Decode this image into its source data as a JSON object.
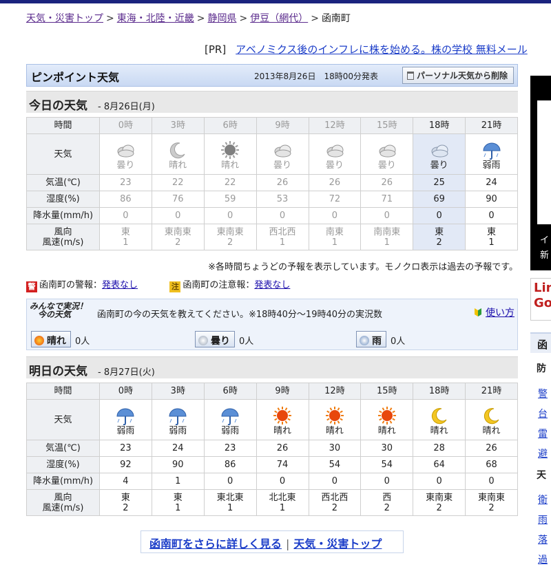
{
  "breadcrumb": {
    "items": [
      "天気・災害トップ",
      "東海・北陸・近畿",
      "静岡県",
      "伊豆（網代）"
    ],
    "current": "函南町",
    "separator": ">"
  },
  "ad": {
    "tag": "[PR]",
    "text": "アベノミクス後のインフレに株を始める。株の学校 無料メール"
  },
  "pinpoint": {
    "title": "ピンポイント天気",
    "published": "2013年8月26日　18時00分発表",
    "remove_button": "パーソナル天気から削除"
  },
  "row_labels": {
    "time": "時間",
    "weather": "天気",
    "temp": "気温(℃)",
    "humidity": "湿度(%)",
    "precip": "降水量(mm/h)",
    "wind_dir": "風向",
    "wind_speed": "風速(m/s)"
  },
  "today": {
    "title": "今日の天気",
    "date": "- 8月26日(月)",
    "columns": [
      {
        "time": "0時",
        "icon": "cloudy-icon",
        "weather": "曇り",
        "temp": "23",
        "humidity": "86",
        "precip": "0",
        "wind_dir": "東",
        "wind_speed": "1",
        "past": true
      },
      {
        "time": "3時",
        "icon": "moon-icon",
        "weather": "晴れ",
        "temp": "22",
        "humidity": "76",
        "precip": "0",
        "wind_dir": "東南東",
        "wind_speed": "2",
        "past": true
      },
      {
        "time": "6時",
        "icon": "sun-icon",
        "weather": "晴れ",
        "temp": "22",
        "humidity": "59",
        "precip": "0",
        "wind_dir": "東南東",
        "wind_speed": "2",
        "past": true
      },
      {
        "time": "9時",
        "icon": "cloudy-icon",
        "weather": "曇り",
        "temp": "26",
        "humidity": "53",
        "precip": "0",
        "wind_dir": "西北西",
        "wind_speed": "1",
        "past": true
      },
      {
        "time": "12時",
        "icon": "cloudy-icon",
        "weather": "曇り",
        "temp": "26",
        "humidity": "72",
        "precip": "0",
        "wind_dir": "南東",
        "wind_speed": "1",
        "past": true
      },
      {
        "time": "15時",
        "icon": "cloudy-icon",
        "weather": "曇り",
        "temp": "26",
        "humidity": "71",
        "precip": "0",
        "wind_dir": "南南東",
        "wind_speed": "1",
        "past": true
      },
      {
        "time": "18時",
        "icon": "cloudy-icon",
        "weather": "曇り",
        "temp": "25",
        "humidity": "69",
        "precip": "0",
        "wind_dir": "東",
        "wind_speed": "2",
        "past": false
      },
      {
        "time": "21時",
        "icon": "rain-icon",
        "weather": "弱雨",
        "temp": "24",
        "humidity": "90",
        "precip": "0",
        "wind_dir": "東",
        "wind_speed": "1",
        "past": false
      }
    ]
  },
  "note": "※各時間ちょうどの予報を表示しています。モノクロ表示は過去の予報です。",
  "alerts": {
    "warning_badge": "警",
    "warning_label": "函南町の警報：",
    "warning_value": "発表なし",
    "advisory_badge": "注",
    "advisory_label": "函南町の注意報：",
    "advisory_value": "発表なし"
  },
  "minna": {
    "logo_line1": "みんなで実況！",
    "logo_line2": "今の天気",
    "prompt": "函南町の今の天気を教えてください。※18時40分～19時40分の実況数",
    "howto": "使い方",
    "votes": [
      {
        "label": "晴れ",
        "count": "0人"
      },
      {
        "label": "曇り",
        "count": "0人"
      },
      {
        "label": "雨",
        "count": "0人"
      }
    ]
  },
  "tomorrow": {
    "title": "明日の天気",
    "date": "- 8月27日(火)",
    "columns": [
      {
        "time": "0時",
        "icon": "rain-icon",
        "weather": "弱雨",
        "temp": "23",
        "humidity": "92",
        "precip": "4",
        "wind_dir": "東",
        "wind_speed": "2"
      },
      {
        "time": "3時",
        "icon": "rain-icon",
        "weather": "弱雨",
        "temp": "24",
        "humidity": "90",
        "precip": "1",
        "wind_dir": "東",
        "wind_speed": "1"
      },
      {
        "time": "6時",
        "icon": "rain-icon",
        "weather": "弱雨",
        "temp": "23",
        "humidity": "86",
        "precip": "0",
        "wind_dir": "東北東",
        "wind_speed": "1"
      },
      {
        "time": "9時",
        "icon": "sun-icon",
        "weather": "晴れ",
        "temp": "26",
        "humidity": "74",
        "precip": "0",
        "wind_dir": "北北東",
        "wind_speed": "1"
      },
      {
        "time": "12時",
        "icon": "sun-icon",
        "weather": "晴れ",
        "temp": "30",
        "humidity": "54",
        "precip": "0",
        "wind_dir": "西北西",
        "wind_speed": "2"
      },
      {
        "time": "15時",
        "icon": "sun-icon",
        "weather": "晴れ",
        "temp": "30",
        "humidity": "54",
        "precip": "0",
        "wind_dir": "西",
        "wind_speed": "2"
      },
      {
        "time": "18時",
        "icon": "moon-icon",
        "weather": "晴れ",
        "temp": "28",
        "humidity": "64",
        "precip": "0",
        "wind_dir": "東南東",
        "wind_speed": "2"
      },
      {
        "time": "21時",
        "icon": "moon-icon",
        "weather": "晴れ",
        "temp": "26",
        "humidity": "68",
        "precip": "0",
        "wind_dir": "東南東",
        "wind_speed": "2"
      }
    ]
  },
  "footer_links": {
    "detail": "函南町をさらに詳しく見る",
    "sep": "|",
    "top": "天気・災害トップ"
  },
  "sidebar": {
    "ad_text_1": "イ",
    "ad_text_2": "新",
    "line_text_1": "Lin",
    "line_text_2": "Go",
    "heading": "函",
    "sub1": "防",
    "links1": [
      "警",
      "台",
      "雷",
      "避"
    ],
    "sub2": "天",
    "links2": [
      "衛",
      "雨",
      "落",
      "過"
    ]
  },
  "colors": {
    "accent": "#1a3cc8",
    "header_bar": "#1a237e",
    "warning": "#d32020",
    "advisory": "#f0c020"
  }
}
